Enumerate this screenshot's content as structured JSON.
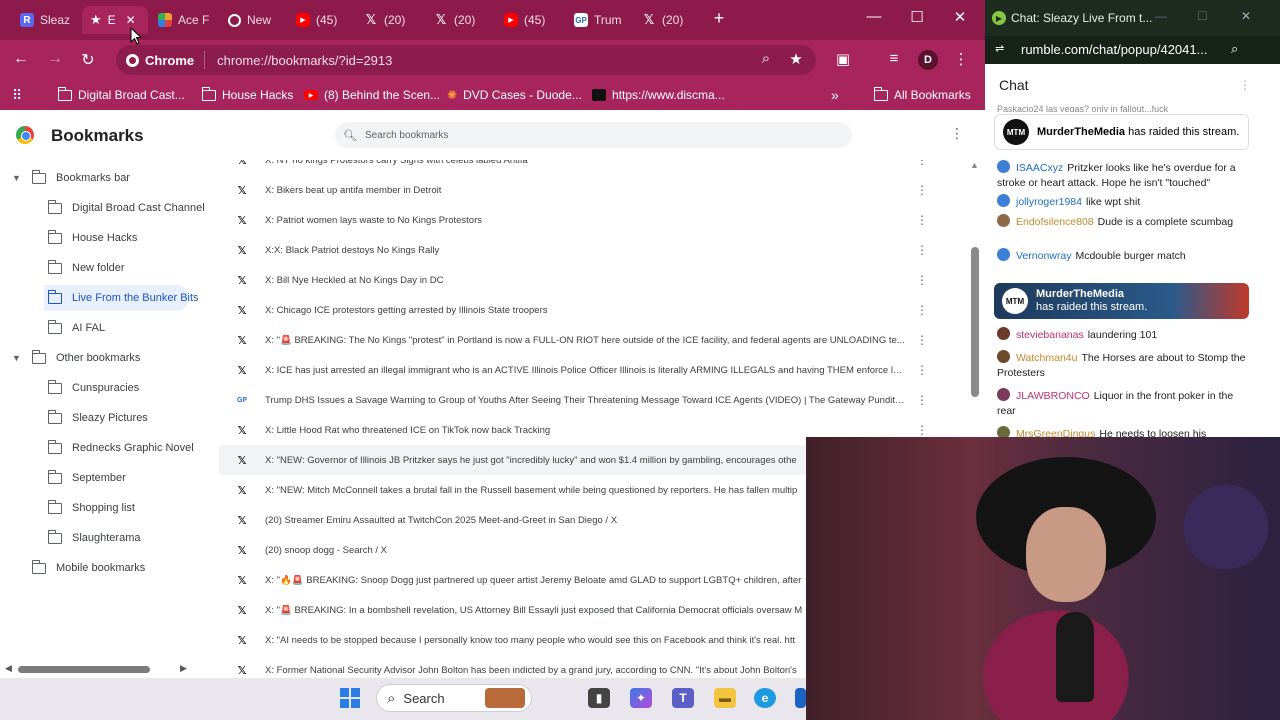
{
  "chrome": {
    "tabs": [
      {
        "label": "Sleaz",
        "icon": "rumble-icon",
        "color": "#5b6af0"
      },
      {
        "label": "E",
        "icon": "star-icon",
        "color": "#ffffff",
        "active": true
      },
      {
        "label": "Ace F",
        "icon": "nbc-icon",
        "color": "#f0a030"
      },
      {
        "label": "New",
        "icon": "chrome-icon",
        "color": "#ffffff"
      },
      {
        "label": "(45)",
        "icon": "youtube-icon",
        "color": "#ff0000"
      },
      {
        "label": "(20)",
        "icon": "x-icon",
        "color": "#000000"
      },
      {
        "label": "(20)",
        "icon": "x-icon",
        "color": "#000000"
      },
      {
        "label": "(45)",
        "icon": "youtube-icon",
        "color": "#ff0000"
      },
      {
        "label": "Trum",
        "icon": "gp-icon",
        "color": "#ffffff"
      },
      {
        "label": "(20)",
        "icon": "x-icon",
        "color": "#000000"
      }
    ],
    "chip_label": "Chrome",
    "url": "chrome://bookmarks/?id=2913",
    "profile_initial": "D",
    "bookmarks_bar": [
      {
        "label": "Digital Broad Cast..."
      },
      {
        "label": "House Hacks"
      },
      {
        "label": "(8) Behind the Scen..."
      },
      {
        "label": "DVD Cases - Duode..."
      },
      {
        "label": "https://www.discma..."
      }
    ],
    "all_bookmarks_label": "All Bookmarks",
    "manager_title": "Bookmarks",
    "search_placeholder": "Search bookmarks",
    "sidebar": [
      {
        "label": "Bookmarks bar",
        "level": 0,
        "caret": "▼"
      },
      {
        "label": "Digital Broad Cast Channel",
        "level": 1
      },
      {
        "label": "House Hacks",
        "level": 1
      },
      {
        "label": "New folder",
        "level": 1
      },
      {
        "label": "Live From the Bunker Bits",
        "level": 1,
        "selected": true
      },
      {
        "label": "AI FAL",
        "level": 1
      },
      {
        "label": "Other bookmarks",
        "level": 0,
        "caret": "▼"
      },
      {
        "label": "Cunspuracies",
        "level": 1
      },
      {
        "label": "Sleazy Pictures",
        "level": 1
      },
      {
        "label": "Rednecks Graphic Novel",
        "level": 1
      },
      {
        "label": "September",
        "level": 1
      },
      {
        "label": "Shopping list",
        "level": 1
      },
      {
        "label": "Slaughterama",
        "level": 1
      },
      {
        "label": "Mobile bookmarks",
        "level": 0
      }
    ],
    "bookmarks": [
      {
        "title": "X: NY no kings Protestors carry Signs with celebs labled Antifa",
        "icon": "x"
      },
      {
        "title": "X: Bikers beat up antifa member in Detroit",
        "icon": "x"
      },
      {
        "title": "X: Patriot women lays waste to No Kings Protestors",
        "icon": "x"
      },
      {
        "title": "X:X: Black Patriot destoys No Kings Rally",
        "icon": "x"
      },
      {
        "title": "X: Bill Nye Heckled at No Kings Day in DC",
        "icon": "x"
      },
      {
        "title": "X: Chicago ICE protestors getting arrested by Illinois State troopers",
        "icon": "x"
      },
      {
        "title": "X: \"🚨 BREAKING: The No Kings \"protest\" in Portland is now a FULL-ON RIOT here outside of the ICE facility, and federal agents are UNLOADING te...",
        "icon": "x"
      },
      {
        "title": "X: ICE has just arrested an illegal immigrant who is an ACTIVE Illinois Police Officer Illinois is literally ARMING ILLEGALS and having THEM enforce la...",
        "icon": "x"
      },
      {
        "title": "Trump DHS Issues a Savage Warning to Group of Youths After Seeing Their Threatening Message Toward ICE Agents (VIDEO) | The Gateway Pundit | ...",
        "icon": "gp"
      },
      {
        "title": "X: Little Hood Rat who threatened ICE on TikTok now back Tracking",
        "icon": "x"
      },
      {
        "title": "X: \"NEW: Governor of Illinois JB Pritzker says he just got \"incredibly lucky\" and won $1.4 million by gambling, encourages othe",
        "icon": "x",
        "highlight": true
      },
      {
        "title": "X: \"NEW: Mitch McConnell takes a brutal fall in the Russell basement while being questioned by reporters. He has fallen multip",
        "icon": "x"
      },
      {
        "title": "(20) Streamer Emiru Assaulted at TwitchCon 2025 Meet-and-Greet in San Diego / X",
        "icon": "x"
      },
      {
        "title": "(20) snoop dogg - Search / X",
        "icon": "x"
      },
      {
        "title": "X: \"🔥🚨 BREAKING: Snoop Dogg just partnered up queer artist Jeremy Beloate amd GLAD to support LGBTQ+ children, after",
        "icon": "x"
      },
      {
        "title": "X: \"🚨 BREAKING: In a bombshell revelation, US Attorney Bill Essayli just exposed that California Democrat officials oversaw M",
        "icon": "x"
      },
      {
        "title": "X: \"AI needs to be stopped because I personally know too many people who would see this on Facebook and think it's real. htt",
        "icon": "x"
      },
      {
        "title": "X: Former National Security Advisor John Bolton has been indicted by a grand jury, according to CNN. \"It's about John Bolton's",
        "icon": "x"
      }
    ]
  },
  "chat": {
    "window_title": "Chat: Sleazy Live From t...",
    "url": "rumble.com/chat/popup/42041...",
    "header": "Chat",
    "partial_top": "Paskacio24  las vegas? only in fallout...fuck",
    "raid1": {
      "user": "MurderTheMedia",
      "text": "has raided this stream."
    },
    "messages_a": [
      {
        "user": "ISAACxyz",
        "text": "Pritzker looks like he's overdue for a stroke or heart attack. Hope he isn't \"touched\"",
        "color": "#1f6fc1",
        "badge": "#3d7fd6"
      },
      {
        "user": "jollyroger1984",
        "text": "like wpt shit",
        "color": "#1f6fc1",
        "badge": "#3d7fd6"
      },
      {
        "user": "Endofsilence808",
        "text": "Dude is a complete scumbag",
        "color": "#c08a2a",
        "badge": "#8c6a4a"
      },
      {
        "user": "Vernonwray",
        "text": "Mcdouble burger match",
        "color": "#1f6fc1",
        "badge": "#3d7fd6"
      }
    ],
    "raid2": {
      "user": "MurderTheMedia",
      "text": "has raided this stream."
    },
    "messages_b": [
      {
        "user": "steviebananas",
        "text": "laundering 101",
        "color": "#c03070",
        "badge": "#6b3a2a"
      },
      {
        "user": "Watchman4u",
        "text": "The Horses are about to Stomp the Protesters",
        "color": "#c08a2a",
        "badge": "#6b4a2a"
      },
      {
        "user": "JLAWBRONCO",
        "text": "Liquor in the front poker in the rear",
        "color": "#c03070",
        "badge": "#7a3a5a"
      },
      {
        "user": "MrsGreenDingus",
        "text": "He needs to loosen his",
        "color": "#c08a2a",
        "badge": "#6a6a3a"
      }
    ]
  },
  "taskbar": {
    "search_label": "Search"
  }
}
